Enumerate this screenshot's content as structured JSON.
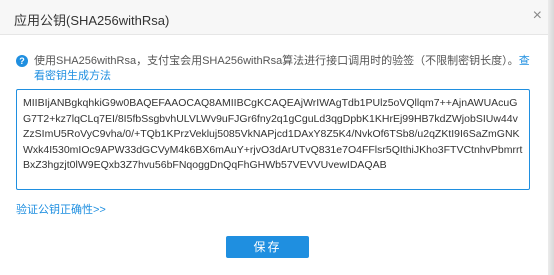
{
  "dialog": {
    "title": "应用公钥(SHA256withRsa)",
    "close_glyph": "×"
  },
  "info": {
    "icon_glyph": "?",
    "text": "使用SHA256withRsa，支付宝会用SHA256withRsa算法进行接口调用时的验签（不限制密钥长度）。",
    "link_label": "查看密钥生成方法"
  },
  "public_key": {
    "value": "MIIBIjANBgkqhkiG9w0BAQEFAAOCAQ8AMIIBCgKCAQEAjWrIWAgTdb1PUlz5oVQllqm7++AjnAWUAcuGG7T2+kz7lqCLq7EI/8I5fbSsgbvhULVLWv9uFJGr6fny2q1gCguLd3qgDpbK1KHrEj99HB7kdZWjobSIUw44vZzSImU5RoVyC9vha/0/+TQb1KPrzVekluj5085VkNAPjcd1DAxY8Z5K4/NvkOf6TSb8/u2qZKtI9I6SaZmGNKWxk4I530mIOc9APW33dGCVyM4k6BX6mAuY+rjvO3dArUTvQ831e7O4FFlsr5QIthiJKho3FTVCtnhvPbmrrtBxZ3hgzjt0lW9EQxb3Z7hvu56bFNqoggDnQqFhGHWb57VEVVUvewIDAQAB"
  },
  "verify_link": "验证公钥正确性>>",
  "save_button": "保存"
}
